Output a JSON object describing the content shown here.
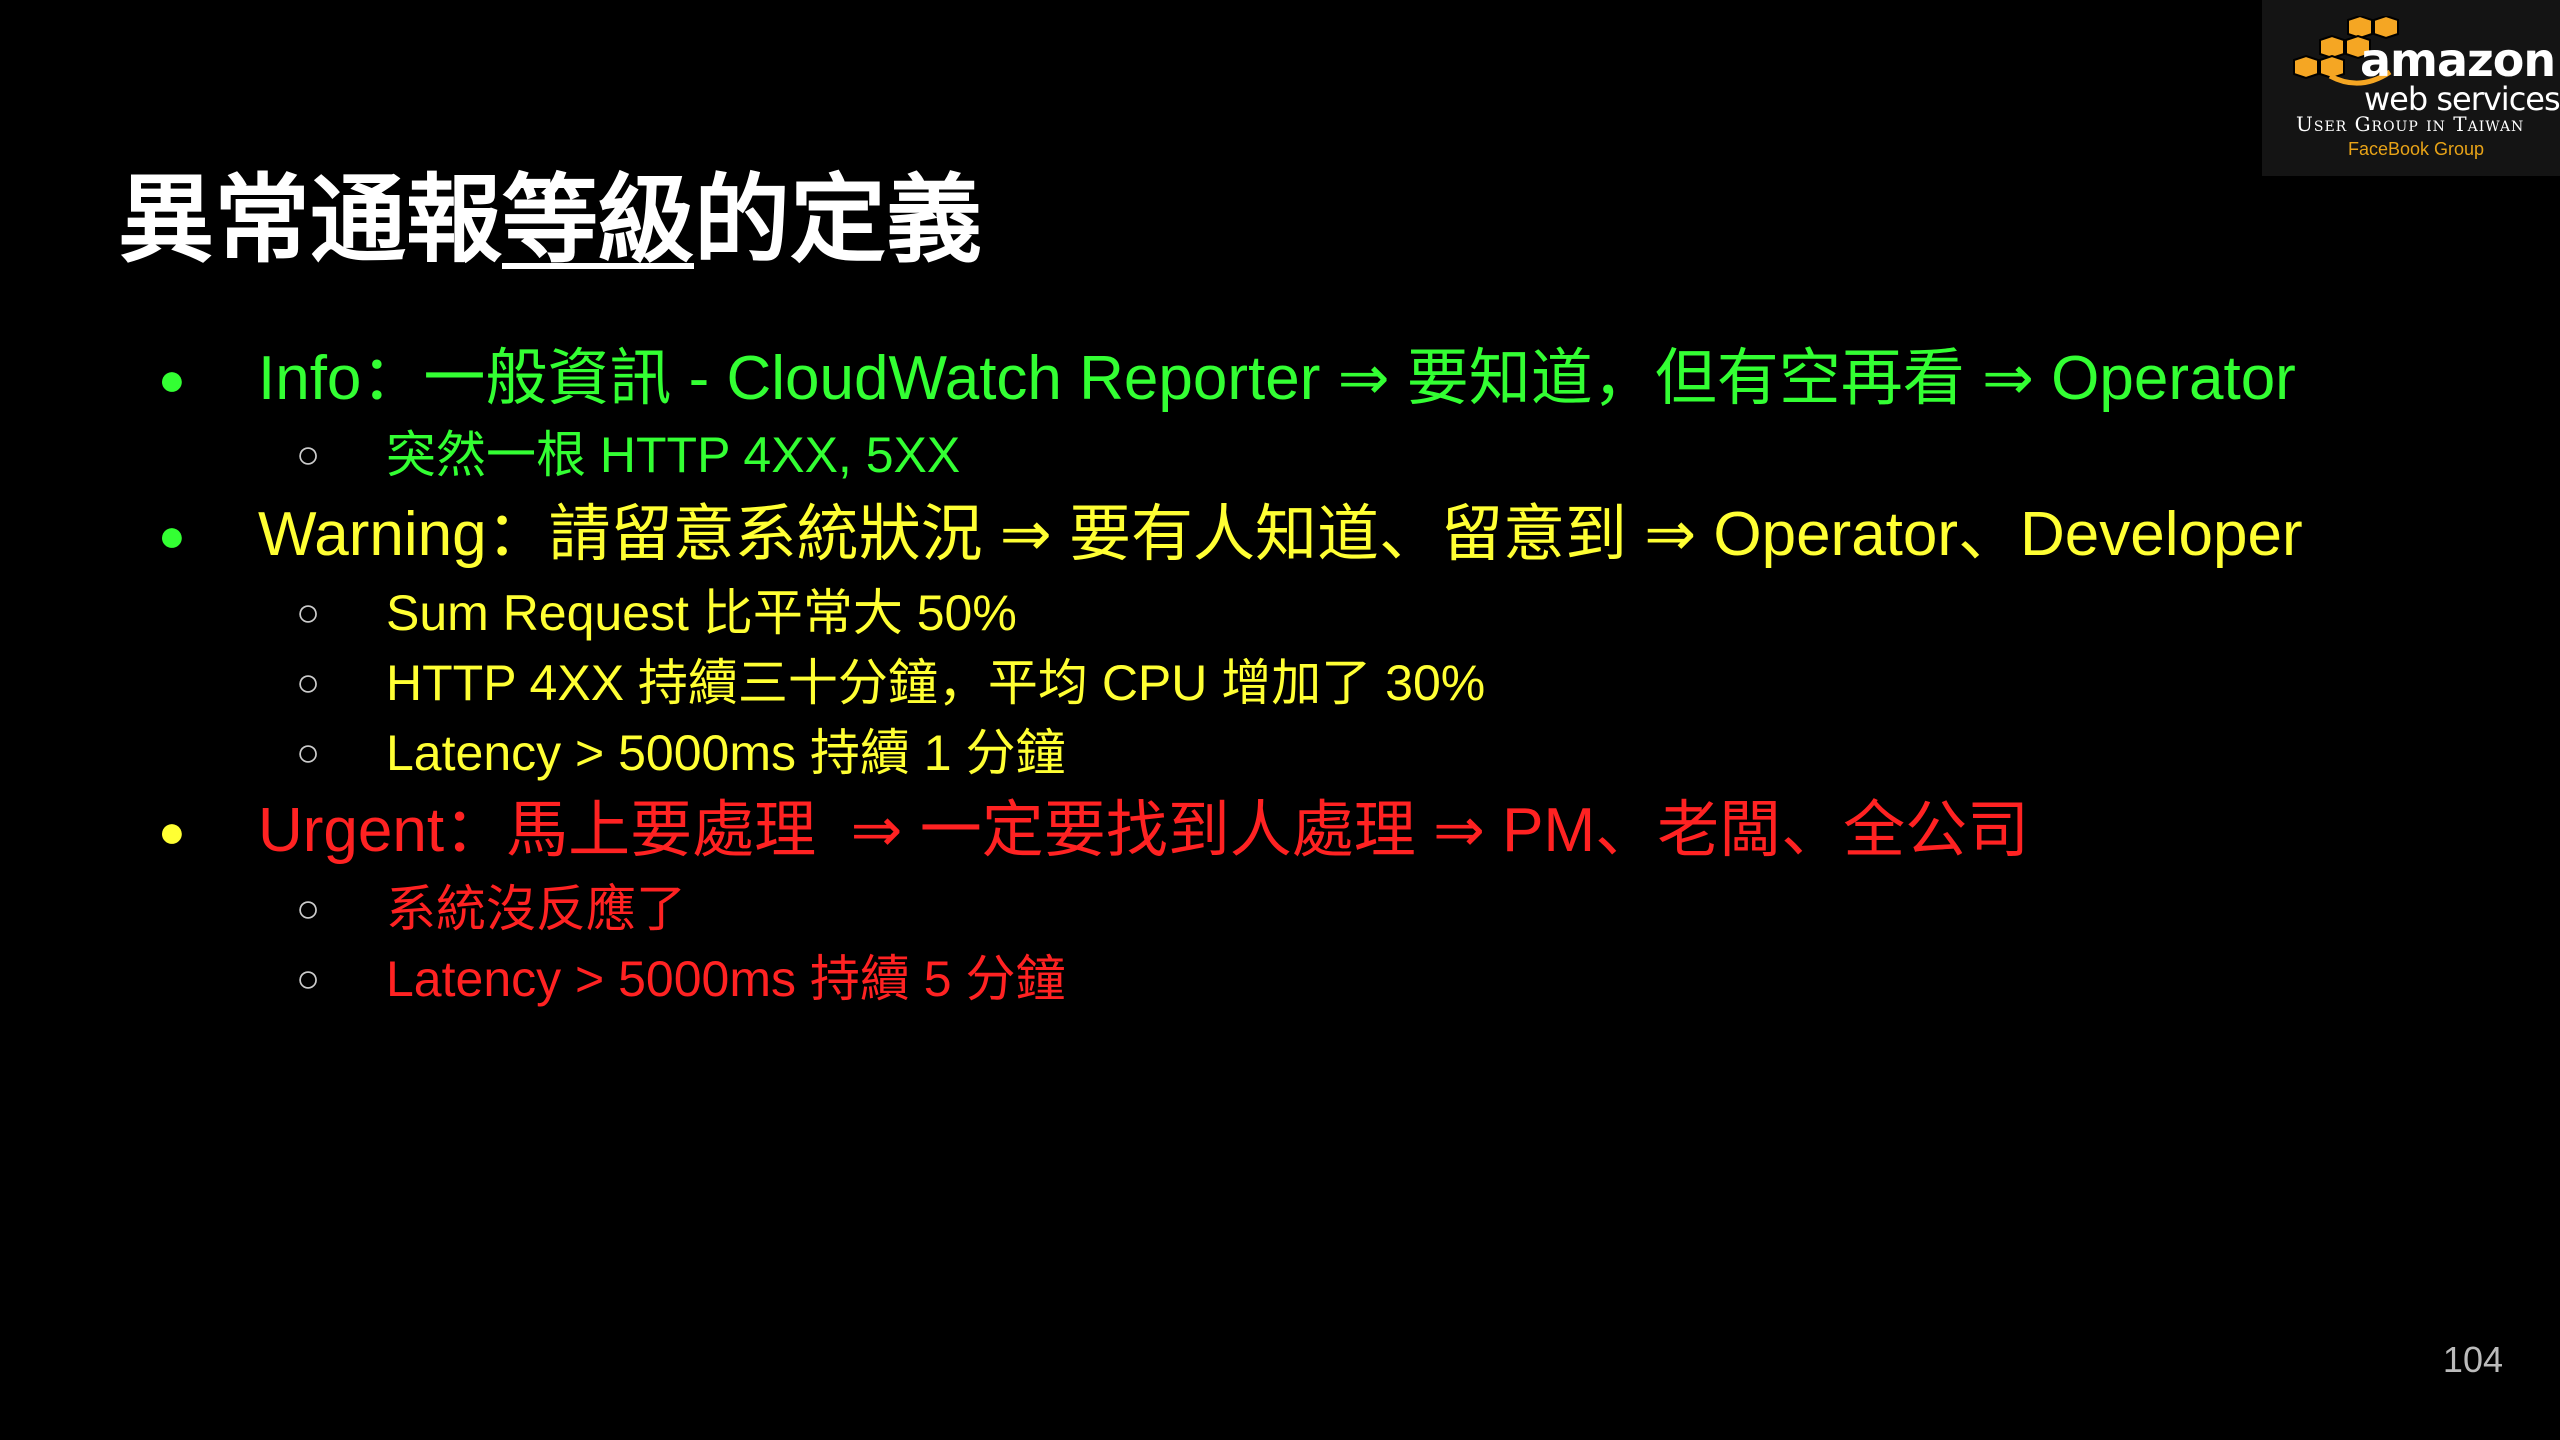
{
  "title": {
    "before": "異常通報",
    "underlined": "等級",
    "after": "的定義"
  },
  "bullets": [
    {
      "text": "Info：一般資訊 - CloudWatch Reporter ⇒ 要知道，但有空再看 ⇒ Operator",
      "color": "#33ff33",
      "marker_color": "#33ff33",
      "sub": [
        {
          "text": "突然一根 HTTP 4XX, 5XX"
        }
      ]
    },
    {
      "text": "Warning：請留意系統狀況 ⇒ 要有人知道、留意到 ⇒ Operator、Developer",
      "color": "#ffff33",
      "marker_color": "#33ff33",
      "sub": [
        {
          "text": "Sum Request 比平常大 50%"
        },
        {
          "text": "HTTP 4XX 持續三十分鐘，平均 CPU 增加了 30%"
        },
        {
          "text": "Latency > 5000ms 持續 1 分鐘"
        }
      ]
    },
    {
      "text": "Urgent：馬上要處理  ⇒ 一定要找到人處理 ⇒ PM、老闆、全公司",
      "color": "#ff2222",
      "marker_color": "#ffff33",
      "sub": [
        {
          "text": "系統沒反應了"
        },
        {
          "text": "Latency > 5000ms 持續 5 分鐘"
        }
      ]
    }
  ],
  "markers": {
    "level1": "●",
    "level2": "○"
  },
  "logo": {
    "name": "aws-logo",
    "line1": "amazon",
    "line2": "web services",
    "line3": "User Group in Taiwan",
    "line4": "FaceBook Group",
    "cube_color": "#f5a623"
  },
  "page_number": "104"
}
